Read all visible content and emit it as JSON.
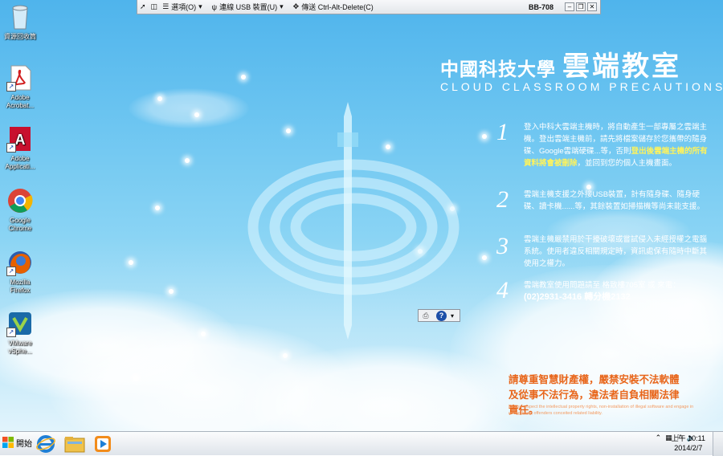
{
  "vmware_bar": {
    "options_label": "選項(O)",
    "usb_label": "連線 USB 裝置(U)",
    "cad_label": "傳送 Ctrl-Alt-Delete(C)",
    "machine_name": "BB-708"
  },
  "desktop_icons": [
    {
      "label": "資源回收筒",
      "icon": "recycle-bin-icon"
    },
    {
      "label": "Adobe Acrobat...",
      "icon": "adobe-acrobat-icon"
    },
    {
      "label": "Adobe Applicati...",
      "icon": "adobe-application-icon"
    },
    {
      "label": "Google Chrome",
      "icon": "chrome-icon"
    },
    {
      "label": "Mozilla Firefox",
      "icon": "firefox-icon"
    },
    {
      "label": "VMware vSphe...",
      "icon": "vmware-vsphere-icon"
    }
  ],
  "wallpaper": {
    "title_cn_prefix": "中國科技大學",
    "title_cn_main": "雲端教室",
    "title_en": "CLOUD CLASSROOM PRECAUTIONS",
    "rules": [
      {
        "num": "1",
        "text_before": "登入中科大雲端主機時，將自動產生一部專屬之雲端主機。登出雲端主機前，請先將檔案儲存於您攜帶的隨身碟、Google雲端硬碟...等，否則",
        "highlight": "登出後雲端主機的所有資料將會被刪除",
        "text_after": "，並回到您的個人主機畫面。"
      },
      {
        "num": "2",
        "text": "雲端主機支援之外接USB裝置，計有隨身碟、隨身硬碟、讀卡機......等，其餘裝置如掃描機等尚未能支援。"
      },
      {
        "num": "3",
        "text": "雲端主機嚴禁用於干擾破壞或嘗試侵入未經授權之電腦系統。使用者違反相關規定時，資訊處保有隨時中斷其使用之權力。"
      },
      {
        "num": "4",
        "line1": "雲端教室使用問題請至 格致樓705室 或 來電：",
        "line2": "(02)2931-3416 轉分機2132"
      }
    ],
    "notice_cn": "請尊重智慧財產權，嚴禁安裝不法軟體及從事不法行為，違法者自負相關法律責任。",
    "notice_en": "Please respect the intellectual property rights, non-installation of illegal software and engage in wrongdoing, offenders conceited related liability."
  },
  "taskbar": {
    "start_label": "開始",
    "apps": [
      "internet-explorer-icon",
      "file-explorer-icon",
      "media-player-icon"
    ],
    "clock_time": "上午 10:11",
    "clock_date": "2014/2/7"
  },
  "colors": {
    "sky": "#6ec6f1",
    "notice": "#e8661b",
    "highlight": "#fff35a"
  }
}
